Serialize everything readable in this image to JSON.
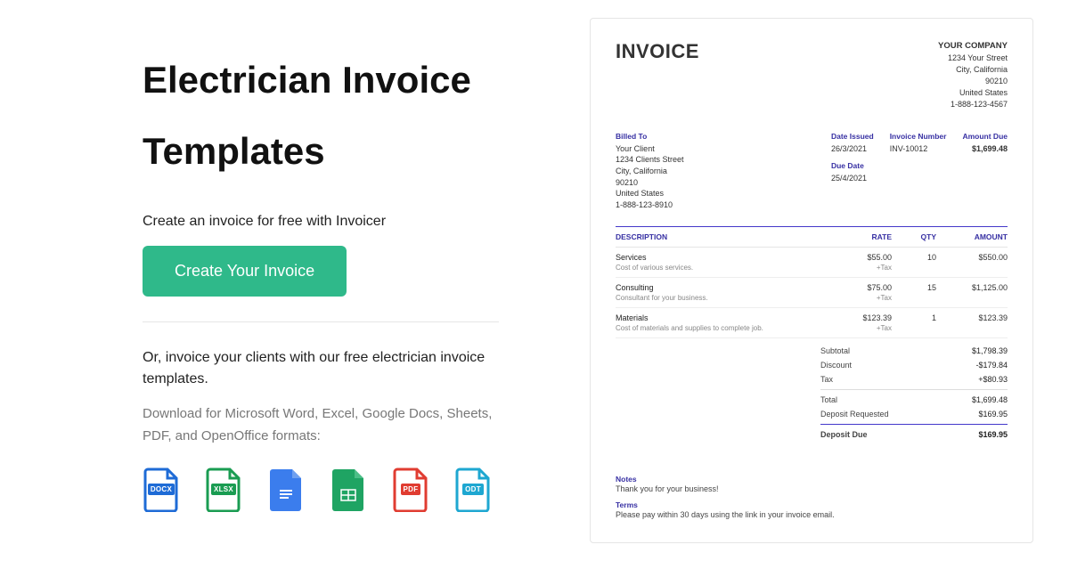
{
  "hero": {
    "title": "Electrician Invoice Templates",
    "subtitle": "Create an invoice for free with Invoicer",
    "cta": "Create Your Invoice",
    "or_line": "Or, invoice your clients with our free electrician invoice templates.",
    "download_line": "Download for Microsoft Word, Excel, Google Docs, Sheets, PDF, and OpenOffice formats:"
  },
  "icons": {
    "docx": "DOCX",
    "xlsx": "XLSX",
    "pdf": "PDF",
    "odt": "ODT"
  },
  "invoice": {
    "heading": "INVOICE",
    "company": {
      "name": "YOUR COMPANY",
      "street": "1234 Your Street",
      "city": "City, California",
      "zip": "90210",
      "country": "United States",
      "phone": "1-888-123-4567"
    },
    "labels": {
      "billed_to": "Billed To",
      "date_issued": "Date Issued",
      "due_date": "Due Date",
      "invoice_number": "Invoice Number",
      "amount_due": "Amount Due",
      "description": "DESCRIPTION",
      "rate": "RATE",
      "qty": "QTY",
      "amount": "AMOUNT",
      "subtotal": "Subtotal",
      "discount": "Discount",
      "tax": "Tax",
      "total": "Total",
      "deposit_requested": "Deposit Requested",
      "deposit_due": "Deposit Due",
      "notes": "Notes",
      "terms": "Terms",
      "plus_tax": "+Tax"
    },
    "client": {
      "name": "Your Client",
      "street": "1234 Clients Street",
      "city": "City, California",
      "zip": "90210",
      "country": "United States",
      "phone": "1-888-123-8910"
    },
    "date_issued": "26/3/2021",
    "due_date": "25/4/2021",
    "number": "INV-10012",
    "amount_due": "$1,699.48",
    "items": [
      {
        "name": "Services",
        "note": "Cost of various services.",
        "rate": "$55.00",
        "qty": "10",
        "amount": "$550.00"
      },
      {
        "name": "Consulting",
        "note": "Consultant for your business.",
        "rate": "$75.00",
        "qty": "15",
        "amount": "$1,125.00"
      },
      {
        "name": "Materials",
        "note": "Cost of materials and supplies to complete job.",
        "rate": "$123.39",
        "qty": "1",
        "amount": "$123.39"
      }
    ],
    "totals": {
      "subtotal": "$1,798.39",
      "discount": "-$179.84",
      "tax": "+$80.93",
      "total": "$1,699.48",
      "deposit_requested": "$169.95",
      "deposit_due": "$169.95"
    },
    "notes_text": "Thank you for your business!",
    "terms_text": "Please pay within 30 days using the link in your invoice email."
  }
}
